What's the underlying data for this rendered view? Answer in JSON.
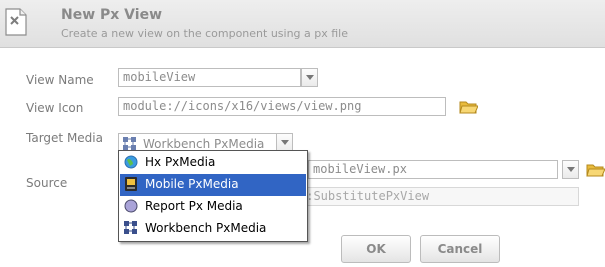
{
  "dialog": {
    "title": "New Px View",
    "subtitle": "Create a new view on the component using a px file"
  },
  "form": {
    "view_name": {
      "label": "View Name",
      "value": "mobileView"
    },
    "view_icon": {
      "label": "View Icon",
      "value": "module://icons/x16/views/view.png"
    },
    "target_media": {
      "label": "Target Media",
      "value": "Workbench PxMedia"
    },
    "source": {
      "label": "Source",
      "file_value": "mobileView.px",
      "type_value": "s:SubstitutePxView"
    }
  },
  "media_options": [
    {
      "label": "Hx PxMedia",
      "icon": "globe-icon",
      "selected": false
    },
    {
      "label": "Mobile PxMedia",
      "icon": "mobile-device-icon",
      "selected": true
    },
    {
      "label": "Report Px Media",
      "icon": "report-circle-icon",
      "selected": false
    },
    {
      "label": "Workbench PxMedia",
      "icon": "workbench-grid-icon",
      "selected": false
    }
  ],
  "buttons": {
    "ok": "OK",
    "cancel": "Cancel"
  },
  "colors": {
    "header_bg": "#e6e6e6",
    "selection": "#3165c4",
    "folder": "#f0c040"
  }
}
